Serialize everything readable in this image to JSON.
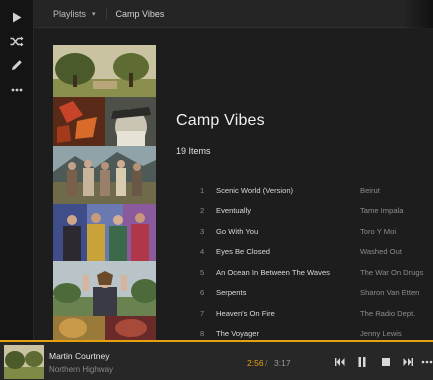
{
  "rail": {
    "icons": [
      "play-icon",
      "shuffle-icon",
      "pencil-icon",
      "more-icon"
    ]
  },
  "topbar": {
    "breadcrumb_root": "Playlists",
    "breadcrumb_current": "Camp Vibes"
  },
  "playlist": {
    "title": "Camp Vibes",
    "count": "19 Items",
    "tracks": [
      {
        "num": "1",
        "title": "Scenic World (Version)",
        "artist": "Beirut"
      },
      {
        "num": "2",
        "title": "Eventually",
        "artist": "Tame Impala"
      },
      {
        "num": "3",
        "title": "Go With You",
        "artist": "Toro Y Moi"
      },
      {
        "num": "4",
        "title": "Eyes Be Closed",
        "artist": "Washed Out"
      },
      {
        "num": "5",
        "title": "An Ocean In Between The Waves",
        "artist": "The War On Drugs"
      },
      {
        "num": "6",
        "title": "Serpents",
        "artist": "Sharon Van Etten"
      },
      {
        "num": "7",
        "title": "Heaven's On Fire",
        "artist": "The Radio Dept."
      },
      {
        "num": "8",
        "title": "The Voyager",
        "artist": "Jenny Lewis"
      }
    ]
  },
  "player": {
    "track_title": "Martin Courtney",
    "track_album": "Northern Highway",
    "elapsed": "2:56",
    "separator": "/",
    "duration": "3:17",
    "controls": [
      "previous-icon",
      "pause-icon",
      "stop-icon",
      "next-icon",
      "more-icon"
    ]
  },
  "colors": {
    "accent": "#e5a00d",
    "background": "#1d1d1d",
    "rail": "#141414"
  }
}
